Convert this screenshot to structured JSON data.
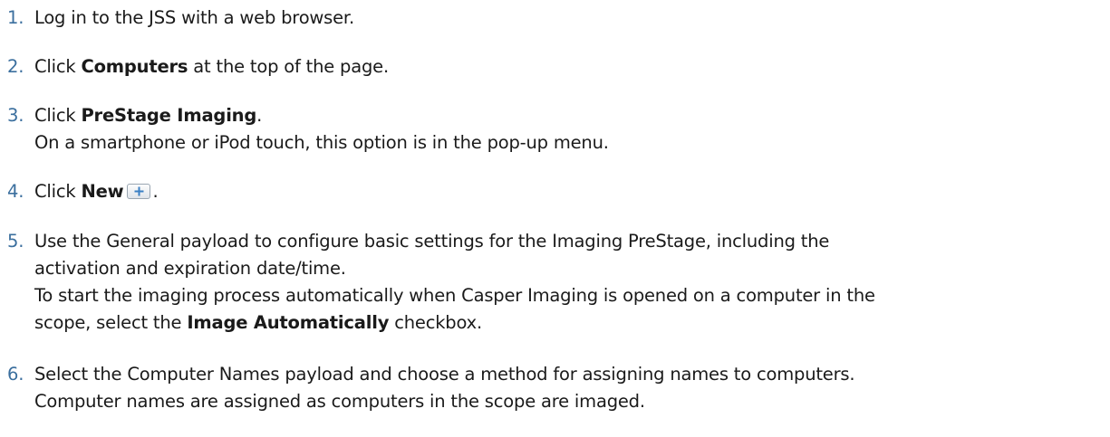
{
  "steps": [
    {
      "number": "1.",
      "text": "Log in to the JSS with a web browser."
    },
    {
      "number": "2.",
      "before": "Click ",
      "bold": "Computers",
      "after": " at the top of the page."
    },
    {
      "number": "3.",
      "before": "Click ",
      "bold": "PreStage Imaging",
      "after": ".",
      "note": "On a smartphone or iPod touch, this option is in the pop-up menu."
    },
    {
      "number": "4.",
      "before": "Click ",
      "bold": "New",
      "icon": "plus-icon",
      "after": "."
    },
    {
      "number": "5.",
      "line1": "Use the General payload to configure basic settings for the Imaging PreStage, including the",
      "line2": "activation and expiration date/time.",
      "line3": "To start the imaging process automatically when Casper Imaging is opened on a computer in the",
      "line4_before": "scope, select the ",
      "line4_bold": "Image Automatically",
      "line4_after": " checkbox."
    },
    {
      "number": "6.",
      "line1": "Select the Computer Names payload and choose a method for assigning names to computers.",
      "line2": "Computer names are assigned as computers in the scope are imaged."
    }
  ],
  "colors": {
    "step_number": "#3b6f9e",
    "text": "#1a1a1a"
  }
}
